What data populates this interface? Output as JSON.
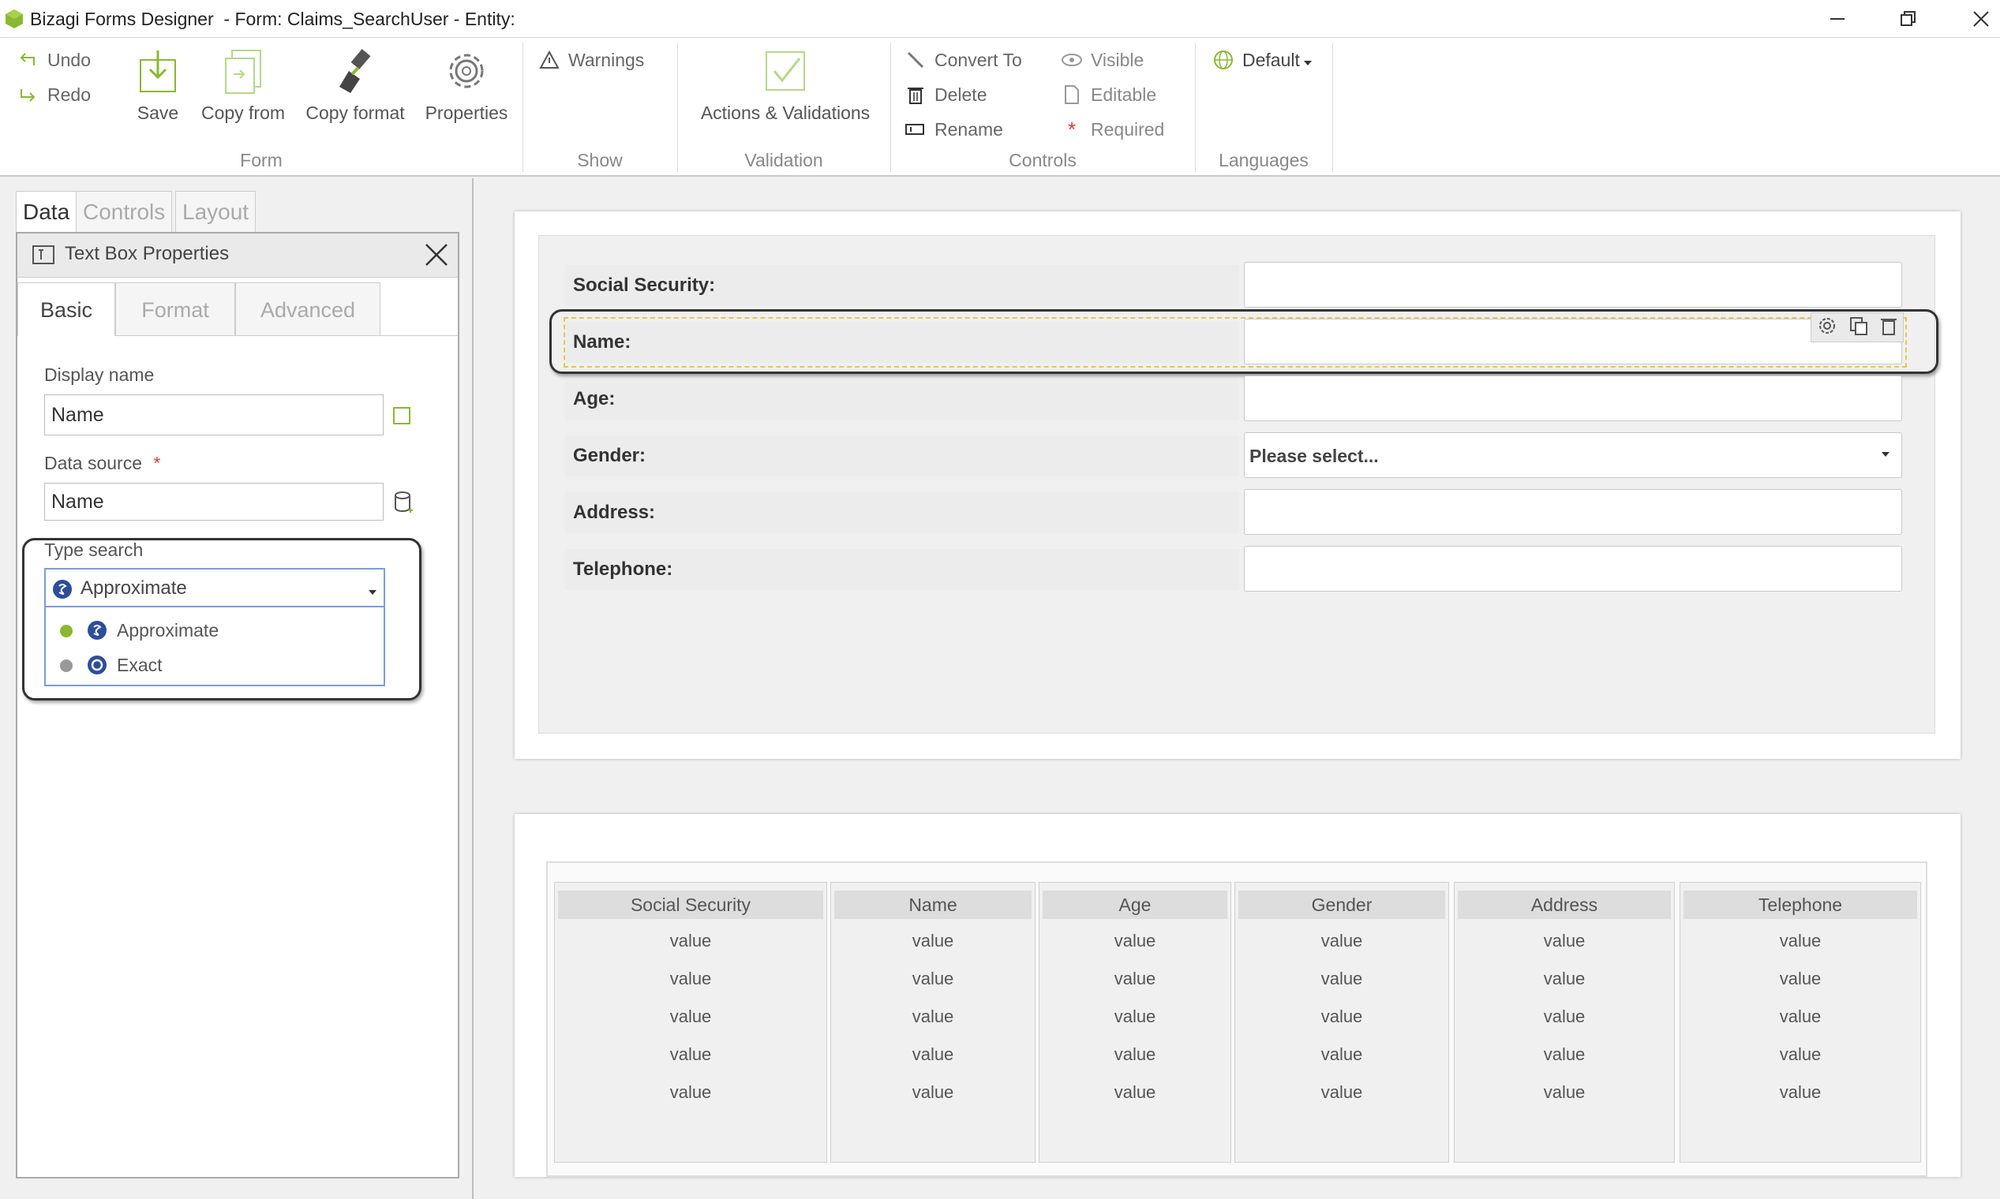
{
  "window": {
    "title": "Bizagi Forms Designer  - Form: Claims_SearchUser - Entity:"
  },
  "ribbon": {
    "undo": "Undo",
    "redo": "Redo",
    "save": "Save",
    "copy_from": "Copy from",
    "copy_format": "Copy format",
    "properties": "Properties",
    "warnings": "Warnings",
    "actions_validations": "Actions & Validations",
    "convert_to": "Convert To",
    "delete": "Delete",
    "rename": "Rename",
    "visible": "Visible",
    "editable": "Editable",
    "required": "Required",
    "language": "Default",
    "groups": {
      "form": "Form",
      "show": "Show",
      "validation": "Validation",
      "controls": "Controls",
      "languages": "Languages"
    }
  },
  "left_panel": {
    "tabs": [
      "Data",
      "Controls",
      "Layout"
    ],
    "properties_title": "Text Box Properties",
    "inner_tabs": [
      "Basic",
      "Format",
      "Advanced"
    ],
    "display_name_label": "Display name",
    "display_name_value": "Name",
    "data_source_label": "Data source",
    "data_source_value": "Name",
    "type_search_label": "Type search",
    "type_search_value": "Approximate",
    "type_search_options": [
      "Approximate",
      "Exact"
    ]
  },
  "form": {
    "fields": [
      {
        "label": "Social Security:",
        "value": ""
      },
      {
        "label": "Name:",
        "value": ""
      },
      {
        "label": "Age:",
        "value": ""
      },
      {
        "label": "Gender:",
        "value": "Please select..."
      },
      {
        "label": "Address:",
        "value": ""
      },
      {
        "label": "Telephone:",
        "value": ""
      }
    ]
  },
  "grid": {
    "columns": [
      "Social Security",
      "Name",
      "Age",
      "Gender",
      "Address",
      "Telephone"
    ],
    "rows": [
      [
        "value",
        "value",
        "value",
        "value",
        "value",
        "value"
      ],
      [
        "value",
        "value",
        "value",
        "value",
        "value",
        "value"
      ],
      [
        "value",
        "value",
        "value",
        "value",
        "value",
        "value"
      ],
      [
        "value",
        "value",
        "value",
        "value",
        "value",
        "value"
      ],
      [
        "value",
        "value",
        "value",
        "value",
        "value",
        "value"
      ]
    ]
  },
  "colors": {
    "accent_green": "#8ab833",
    "required_red": "#e5383b",
    "selection_yellow": "#e8c84a",
    "option_blue": "#2e4d9a"
  }
}
